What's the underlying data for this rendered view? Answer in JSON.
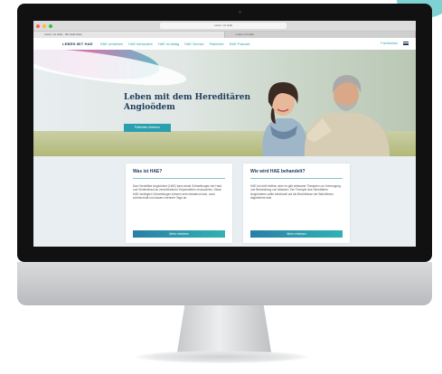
{
  "browser": {
    "address": "Leben mit HAE",
    "tabs": [
      "Leben mit HAE - Mit HAE leben",
      "Leben mit HAE"
    ]
  },
  "nav": {
    "brand": "LEBEN MIT HAE",
    "links": [
      "HAE verstehen",
      "HAE behandeln",
      "HAE im Alltag",
      "HAE Service",
      "Patienten",
      "HAE Podcast"
    ],
    "right_link": "Fachkreise"
  },
  "hero": {
    "title": "Leben mit dem Hereditären Angioödem",
    "button": "Patienten erfahren"
  },
  "cards": [
    {
      "title": "Was ist HAE?",
      "text": "Das Hereditäre Angioödem (HAE) kann akute Schwellungen der Haut und Schleimhaut an verschiedenen Körperstellen verursachen. Diese HAE-bedingten Schwellungen können sehr belastend sein, auch schmerzhaft und dauern mehrere Tage an.",
      "button": "Mehr erfahren"
    },
    {
      "title": "Wie wird HAE behandelt?",
      "text": "HAE ist nicht heilbar, aber es gibt wirksame Therapien zur Vorbeugung und Behandlung von Attacken. Die Therapie des Hereditären Angioödems sollte individuell auf die Bedürfnisse der Betroffenen abgestimmt sein.",
      "button": "Mehr erfahren"
    }
  ]
}
